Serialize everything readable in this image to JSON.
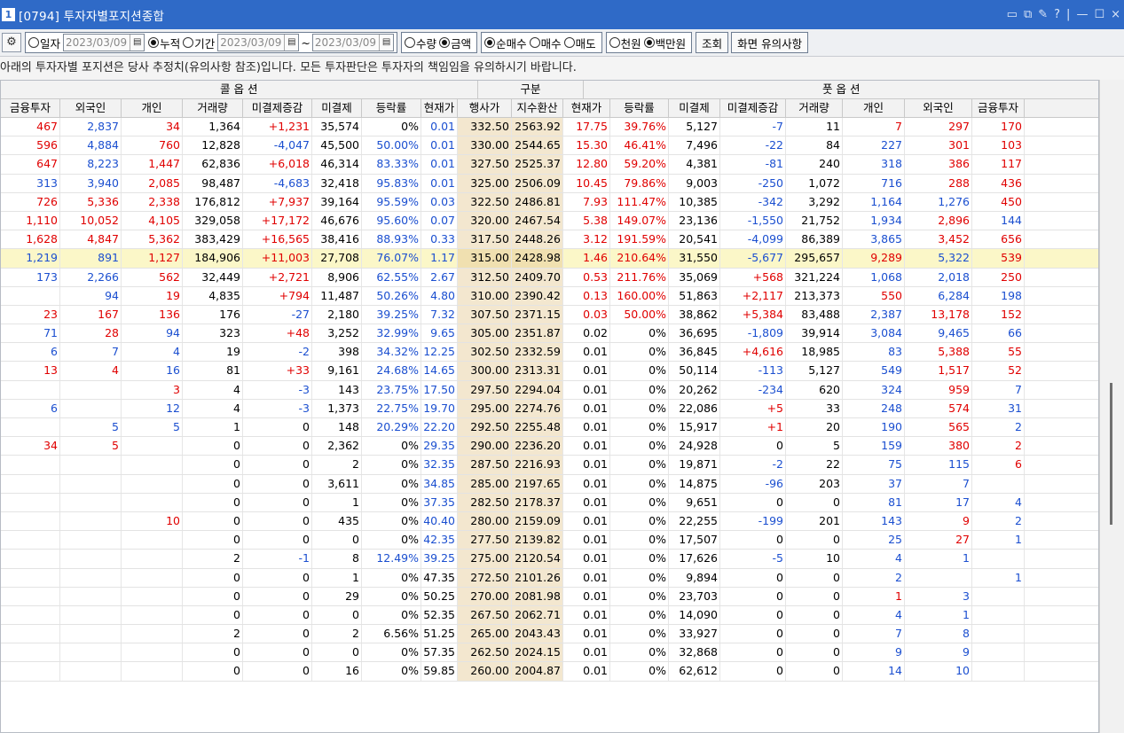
{
  "window": {
    "num": "1",
    "title": "[0794] 투자자별포지션종합",
    "controls": [
      "▭",
      "⧉",
      "✎",
      "?",
      "|",
      "—",
      "☐",
      "×"
    ]
  },
  "toolbar": {
    "gear": "⚙",
    "opt_day": "일자",
    "date1": "2023/03/09",
    "opt_cum": "누적",
    "opt_period": "기간",
    "date2": "2023/03/09",
    "tilde": "~",
    "date3": "2023/03/09",
    "opt_qty": "수량",
    "opt_amt": "금액",
    "opt_net": "순매수",
    "opt_buy": "매수",
    "opt_sell": "매도",
    "opt_thou": "천원",
    "opt_mil": "백만원",
    "search": "조회",
    "notice_btn": "화면 유의사항"
  },
  "notice": "아래의 투자자별 포지션은 당사 추정치(유의사항 참조)입니다. 모든 투자판단은 투자자의 책임임을 유의하시기 바랍니다.",
  "groups": {
    "call": "콜 옵 션",
    "mid": "구분",
    "put": "풋 옵 션"
  },
  "columns": [
    "금융투자",
    "외국인",
    "개인",
    "거래량",
    "미결제증감",
    "미결제",
    "등락률",
    "현재가",
    "행사가",
    "지수환산",
    "현재가",
    "등락률",
    "미결제",
    "미결제증감",
    "거래량",
    "개인",
    "외국인",
    "금융투자"
  ],
  "colors": {
    "red": "#e00000",
    "blue": "#1b4fd0",
    "title_bg": "#2f6ac7",
    "strike_bg": "#f3e7cf",
    "highlight": "#fbf7c8"
  },
  "rows": [
    [
      "467",
      "2,837",
      "34",
      "1,364",
      "+1,231",
      "35,574",
      "0%",
      "0.01",
      "332.50",
      "2563.92",
      "17.75",
      "39.76%",
      "5,127",
      "-7",
      "11",
      "7",
      "297",
      "170"
    ],
    [
      "596",
      "4,884",
      "760",
      "12,828",
      "-4,047",
      "45,500",
      "50.00%",
      "0.01",
      "330.00",
      "2544.65",
      "15.30",
      "46.41%",
      "7,496",
      "-22",
      "84",
      "227",
      "301",
      "103"
    ],
    [
      "647",
      "8,223",
      "1,447",
      "62,836",
      "+6,018",
      "46,314",
      "83.33%",
      "0.01",
      "327.50",
      "2525.37",
      "12.80",
      "59.20%",
      "4,381",
      "-81",
      "240",
      "318",
      "386",
      "117"
    ],
    [
      "313",
      "3,940",
      "2,085",
      "98,487",
      "-4,683",
      "32,418",
      "95.83%",
      "0.01",
      "325.00",
      "2506.09",
      "10.45",
      "79.86%",
      "9,003",
      "-250",
      "1,072",
      "716",
      "288",
      "436"
    ],
    [
      "726",
      "5,336",
      "2,338",
      "176,812",
      "+7,937",
      "39,164",
      "95.59%",
      "0.03",
      "322.50",
      "2486.81",
      "7.93",
      "111.47%",
      "10,385",
      "-342",
      "3,292",
      "1,164",
      "1,276",
      "450"
    ],
    [
      "1,110",
      "10,052",
      "4,105",
      "329,058",
      "+17,172",
      "46,676",
      "95.60%",
      "0.07",
      "320.00",
      "2467.54",
      "5.38",
      "149.07%",
      "23,136",
      "-1,550",
      "21,752",
      "1,934",
      "2,896",
      "144"
    ],
    [
      "1,628",
      "4,847",
      "5,362",
      "383,429",
      "+16,565",
      "38,416",
      "88.93%",
      "0.33",
      "317.50",
      "2448.26",
      "3.12",
      "191.59%",
      "20,541",
      "-4,099",
      "86,389",
      "3,865",
      "3,452",
      "656"
    ],
    [
      "1,219",
      "891",
      "1,127",
      "184,906",
      "+11,003",
      "27,708",
      "76.07%",
      "1.17",
      "315.00",
      "2428.98",
      "1.46",
      "210.64%",
      "31,550",
      "-5,677",
      "295,657",
      "9,289",
      "5,322",
      "539"
    ],
    [
      "173",
      "2,266",
      "562",
      "32,449",
      "+2,721",
      "8,906",
      "62.55%",
      "2.67",
      "312.50",
      "2409.70",
      "0.53",
      "211.76%",
      "35,069",
      "+568",
      "321,224",
      "1,068",
      "2,018",
      "250"
    ],
    [
      "",
      "94",
      "19",
      "4,835",
      "+794",
      "11,487",
      "50.26%",
      "4.80",
      "310.00",
      "2390.42",
      "0.13",
      "160.00%",
      "51,863",
      "+2,117",
      "213,373",
      "550",
      "6,284",
      "198"
    ],
    [
      "23",
      "167",
      "136",
      "176",
      "-27",
      "2,180",
      "39.25%",
      "7.32",
      "307.50",
      "2371.15",
      "0.03",
      "50.00%",
      "38,862",
      "+5,384",
      "83,488",
      "2,387",
      "13,178",
      "152"
    ],
    [
      "71",
      "28",
      "94",
      "323",
      "+48",
      "3,252",
      "32.99%",
      "9.65",
      "305.00",
      "2351.87",
      "0.02",
      "0%",
      "36,695",
      "-1,809",
      "39,914",
      "3,084",
      "9,465",
      "66"
    ],
    [
      "6",
      "7",
      "4",
      "19",
      "-2",
      "398",
      "34.32%",
      "12.25",
      "302.50",
      "2332.59",
      "0.01",
      "0%",
      "36,845",
      "+4,616",
      "18,985",
      "83",
      "5,388",
      "55"
    ],
    [
      "13",
      "4",
      "16",
      "81",
      "+33",
      "9,161",
      "24.68%",
      "14.65",
      "300.00",
      "2313.31",
      "0.01",
      "0%",
      "50,114",
      "-113",
      "5,127",
      "549",
      "1,517",
      "52"
    ],
    [
      "",
      "",
      "3",
      "4",
      "-3",
      "143",
      "23.75%",
      "17.50",
      "297.50",
      "2294.04",
      "0.01",
      "0%",
      "20,262",
      "-234",
      "620",
      "324",
      "959",
      "7"
    ],
    [
      "6",
      "",
      "12",
      "4",
      "-3",
      "1,373",
      "22.75%",
      "19.70",
      "295.00",
      "2274.76",
      "0.01",
      "0%",
      "22,086",
      "+5",
      "33",
      "248",
      "574",
      "31"
    ],
    [
      "",
      "5",
      "5",
      "1",
      "0",
      "148",
      "20.29%",
      "22.20",
      "292.50",
      "2255.48",
      "0.01",
      "0%",
      "15,917",
      "+1",
      "20",
      "190",
      "565",
      "2"
    ],
    [
      "34",
      "5",
      "",
      "0",
      "0",
      "2,362",
      "0%",
      "29.35",
      "290.00",
      "2236.20",
      "0.01",
      "0%",
      "24,928",
      "0",
      "5",
      "159",
      "380",
      "2"
    ],
    [
      "",
      "",
      "",
      "0",
      "0",
      "2",
      "0%",
      "32.35",
      "287.50",
      "2216.93",
      "0.01",
      "0%",
      "19,871",
      "-2",
      "22",
      "75",
      "115",
      "6"
    ],
    [
      "",
      "",
      "",
      "0",
      "0",
      "3,611",
      "0%",
      "34.85",
      "285.00",
      "2197.65",
      "0.01",
      "0%",
      "14,875",
      "-96",
      "203",
      "37",
      "7",
      ""
    ],
    [
      "",
      "",
      "",
      "0",
      "0",
      "1",
      "0%",
      "37.35",
      "282.50",
      "2178.37",
      "0.01",
      "0%",
      "9,651",
      "0",
      "0",
      "81",
      "17",
      "4"
    ],
    [
      "",
      "",
      "10",
      "0",
      "0",
      "435",
      "0%",
      "40.40",
      "280.00",
      "2159.09",
      "0.01",
      "0%",
      "22,255",
      "-199",
      "201",
      "143",
      "9",
      "2"
    ],
    [
      "",
      "",
      "",
      "0",
      "0",
      "0",
      "0%",
      "42.35",
      "277.50",
      "2139.82",
      "0.01",
      "0%",
      "17,507",
      "0",
      "0",
      "25",
      "27",
      "1"
    ],
    [
      "",
      "",
      "",
      "2",
      "-1",
      "8",
      "12.49%",
      "39.25",
      "275.00",
      "2120.54",
      "0.01",
      "0%",
      "17,626",
      "-5",
      "10",
      "4",
      "1",
      ""
    ],
    [
      "",
      "",
      "",
      "0",
      "0",
      "1",
      "0%",
      "47.35",
      "272.50",
      "2101.26",
      "0.01",
      "0%",
      "9,894",
      "0",
      "0",
      "2",
      "",
      "1"
    ],
    [
      "",
      "",
      "",
      "0",
      "0",
      "29",
      "0%",
      "50.25",
      "270.00",
      "2081.98",
      "0.01",
      "0%",
      "23,703",
      "0",
      "0",
      "1",
      "3",
      ""
    ],
    [
      "",
      "",
      "",
      "0",
      "0",
      "0",
      "0%",
      "52.35",
      "267.50",
      "2062.71",
      "0.01",
      "0%",
      "14,090",
      "0",
      "0",
      "4",
      "1",
      ""
    ],
    [
      "",
      "",
      "",
      "2",
      "0",
      "2",
      "6.56%",
      "51.25",
      "265.00",
      "2043.43",
      "0.01",
      "0%",
      "33,927",
      "0",
      "0",
      "7",
      "8",
      ""
    ],
    [
      "",
      "",
      "",
      "0",
      "0",
      "0",
      "0%",
      "57.35",
      "262.50",
      "2024.15",
      "0.01",
      "0%",
      "32,868",
      "0",
      "0",
      "9",
      "9",
      ""
    ],
    [
      "",
      "",
      "",
      "0",
      "0",
      "16",
      "0%",
      "59.85",
      "260.00",
      "2004.87",
      "0.01",
      "0%",
      "62,612",
      "0",
      "0",
      "14",
      "10",
      ""
    ]
  ]
}
